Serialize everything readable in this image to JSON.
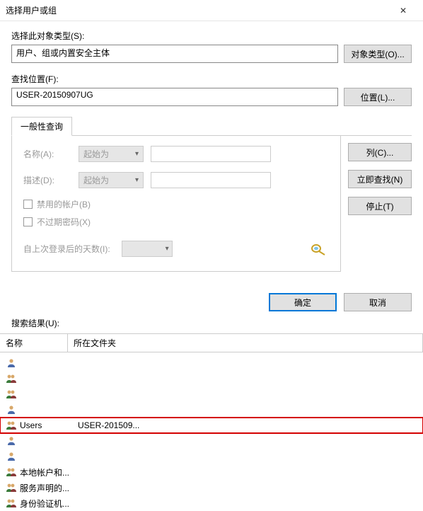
{
  "title": "选择用户或组",
  "labels": {
    "objectTypeTitle": "选择此对象类型(S):",
    "objectTypeValue": "用户、组或内置安全主体",
    "objectTypeBtn": "对象类型(O)...",
    "locationTitle": "查找位置(F):",
    "locationValue": "USER-20150907UG",
    "locationBtn": "位置(L)...",
    "tabGeneral": "一般性查询",
    "nameLabel": "名称(A):",
    "descLabel": "描述(D):",
    "startsWith": "起始为",
    "disabledAccounts": "禁用的帐户(B)",
    "nonExpiringPw": "不过期密码(X)",
    "daysSinceLogon": "自上次登录后的天数(I):",
    "columnsBtn": "列(C)...",
    "findNowBtn": "立即查找(N)",
    "stopBtn": "停止(T)",
    "ok": "确定",
    "cancel": "取消",
    "searchResults": "搜索结果(U):",
    "colName": "名称",
    "colFolder": "所在文件夹"
  },
  "results": [
    {
      "name": "",
      "folder": "",
      "icon": "user",
      "blur": true
    },
    {
      "name": "",
      "folder": "",
      "icon": "group",
      "blur": true
    },
    {
      "name": "",
      "folder": "",
      "icon": "group",
      "blur": true
    },
    {
      "name": "",
      "folder": "",
      "icon": "user",
      "blur": true
    },
    {
      "name": "Users",
      "folder": "USER-201509...",
      "icon": "group",
      "blur": false,
      "highlight": true
    },
    {
      "name": "",
      "folder": "",
      "icon": "user",
      "blur": true
    },
    {
      "name": "",
      "folder": "",
      "icon": "user",
      "blur": true
    },
    {
      "name": "本地帐户和...",
      "folder": "",
      "icon": "group",
      "blur": false
    },
    {
      "name": "服务声明的...",
      "folder": "",
      "icon": "group",
      "blur": false
    },
    {
      "name": "身份验证机...",
      "folder": "",
      "icon": "group",
      "blur": false
    }
  ]
}
